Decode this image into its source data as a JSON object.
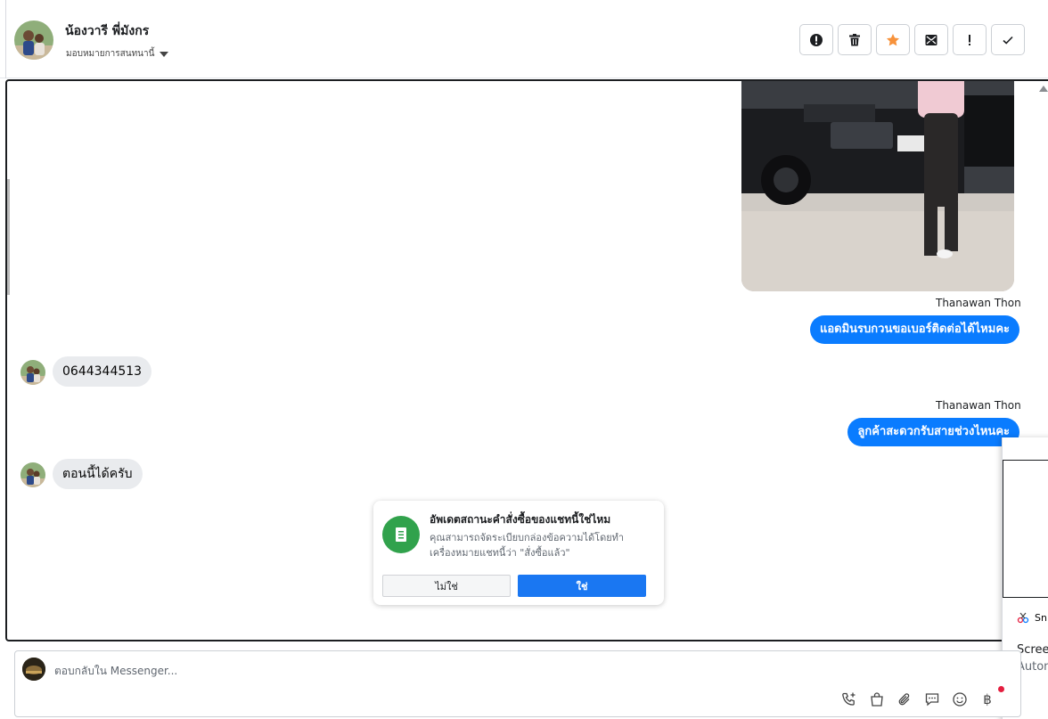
{
  "header": {
    "contact_name": "น้องวารี พี่มังกร",
    "assign_label": "มอบหมายการสนทนานี้",
    "actions": [
      {
        "name": "spam-button",
        "icon": "alert-circle-icon"
      },
      {
        "name": "delete-button",
        "icon": "trash-icon"
      },
      {
        "name": "star-button",
        "icon": "star-icon",
        "color": "#f7923b"
      },
      {
        "name": "mark-unread-button",
        "icon": "envelope-icon"
      },
      {
        "name": "important-button",
        "icon": "exclamation-icon"
      },
      {
        "name": "done-button",
        "icon": "check-icon"
      }
    ]
  },
  "messages": {
    "m1_sender": "Thanawan Thon",
    "m1_text": "แอดมินรบกวนขอเบอร์ติดต่อได้ไหมคะ",
    "m2_text": "0644344513",
    "m3_sender": "Thanawan Thon",
    "m3_text": "ลูกค้าสะดวกรับสายช่วงไหนคะ",
    "m4_text": "ตอนนี้ได้ครับ"
  },
  "prompt_card": {
    "title": "อัพเดตสถานะคำสั่งซื้อของแชทนี้ใช่ไหม",
    "body": "คุณสามารถจัดระเบียบกล่องข้อความได้โดยทำเครื่องหมายแชทนี้ว่า \"สั่งซื้อแล้ว\"",
    "no_label": "ไม่ใช่",
    "yes_label": "ใช่"
  },
  "overlay": {
    "snip_label": "Sn",
    "screen_label": "Screer",
    "auto_label": "Auton"
  },
  "composer": {
    "placeholder": "ตอบกลับใน Messenger...",
    "baht": "฿"
  },
  "colors": {
    "accent": "#0a7cff",
    "confirm": "#1a77f2",
    "card_icon": "#31a24c",
    "star": "#f7923b"
  }
}
